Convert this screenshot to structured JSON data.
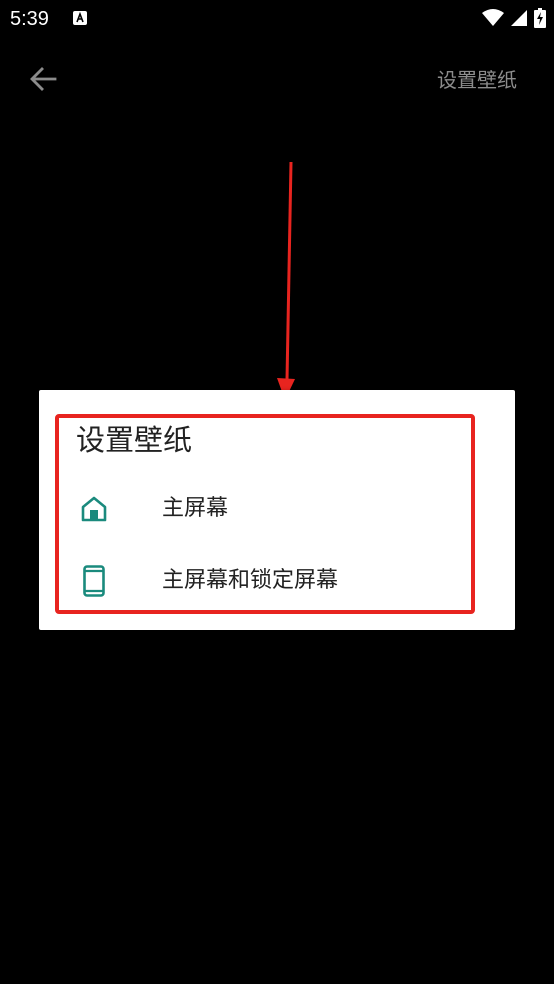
{
  "status_bar": {
    "time": "5:39",
    "notification_icon": "a-notification-icon",
    "wifi_icon": "wifi-icon",
    "signal_icon": "cell-signal-icon",
    "battery_icon": "battery-charging-icon"
  },
  "app_bar": {
    "back_icon": "arrow-back-icon",
    "action_label": "设置壁纸"
  },
  "dialog": {
    "title": "设置壁纸",
    "options": [
      {
        "icon": "home-icon",
        "label": "主屏幕"
      },
      {
        "icon": "phone-icon",
        "label": "主屏幕和锁定屏幕"
      }
    ]
  },
  "colors": {
    "background": "#000000",
    "dialog_bg": "#ffffff",
    "icon_teal": "#1a8a7d",
    "annotation_red": "#e8241f",
    "action_gray": "#8c8c8c"
  }
}
